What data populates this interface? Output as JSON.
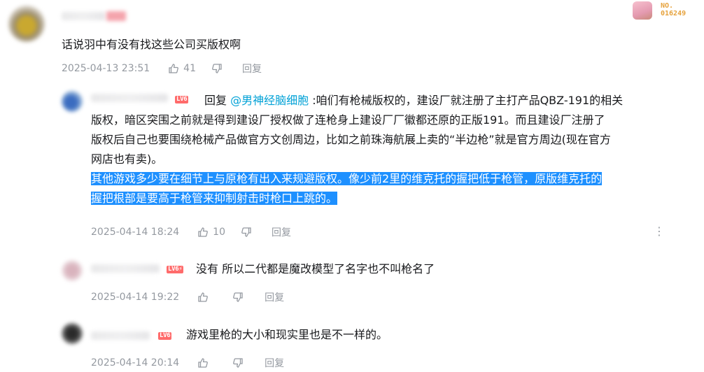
{
  "colors": {
    "accent_link": "#00a1d6",
    "level_badge": "#ff6b6b",
    "selection": "#1e90ff",
    "meta_gray": "#9499a0"
  },
  "top_badge": {
    "line1": "NO.",
    "line2": "016249"
  },
  "main_comment": {
    "text": "话说羽中有没有找这些公司买版权啊",
    "date": "2025-04-13 23:51",
    "likes": "41",
    "reply_label": "回复"
  },
  "replies": [
    {
      "level": "LV6",
      "reply_word": "回复 ",
      "mention": "@男神经脑细胞",
      "lines": [
        " :咱们有枪械版权的，建设厂就注册了主打产品QBZ-191的相关",
        "版权，暗区突围之前就是得到建设厂授权做了连枪身上建设厂厂徽都还原的正版191。而且建设厂注册了",
        "版权后自己也要围绕枪械产品做官方文创周边，比如之前珠海航展上卖的“半边枪”就是官方周边(现在官方",
        "网店也有卖)。"
      ],
      "highlight_lines": [
        "其他游戏多少要在细节上与原枪有出入来规避版权。像少前2里的维克托的握把低于枪管，原版维克托的",
        "握把根部是要高于枪管来抑制射击时枪口上跳的。"
      ],
      "date": "2025-04-14 18:24",
      "likes": "10",
      "reply_label": "回复",
      "more_label": "⋮"
    },
    {
      "level": "LV6⚡",
      "text": "没有 所以二代都是魔改模型了名字也不叫枪名了",
      "date": "2025-04-14 19:22",
      "reply_label": "回复"
    },
    {
      "level": "LV6",
      "text": "游戏里枪的大小和现实里也是不一样的。",
      "date": "2025-04-14 20:14",
      "reply_label": "回复"
    }
  ]
}
